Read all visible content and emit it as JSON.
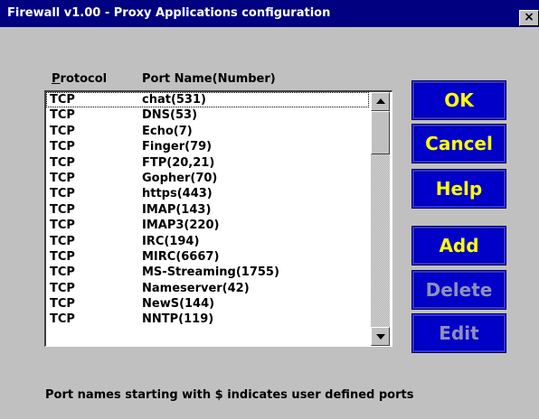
{
  "window": {
    "title": "Firewall v1.00 - Proxy Applications configuration",
    "close_label": "×"
  },
  "list": {
    "header_protocol": "Protocol",
    "header_protocol_mnemonic": "P",
    "header_protocol_rest": "rotocol",
    "header_port": "Port Name(Number)",
    "selected_index": 0,
    "rows": [
      {
        "protocol": "TCP",
        "port": "chat(531)"
      },
      {
        "protocol": "TCP",
        "port": "DNS(53)"
      },
      {
        "protocol": "TCP",
        "port": "Echo(7)"
      },
      {
        "protocol": "TCP",
        "port": "Finger(79)"
      },
      {
        "protocol": "TCP",
        "port": "FTP(20,21)"
      },
      {
        "protocol": "TCP",
        "port": "Gopher(70)"
      },
      {
        "protocol": "TCP",
        "port": "https(443)"
      },
      {
        "protocol": "TCP",
        "port": "IMAP(143)"
      },
      {
        "protocol": "TCP",
        "port": "IMAP3(220)"
      },
      {
        "protocol": "TCP",
        "port": "IRC(194)"
      },
      {
        "protocol": "TCP",
        "port": "MIRC(6667)"
      },
      {
        "protocol": "TCP",
        "port": "MS-Streaming(1755)"
      },
      {
        "protocol": "TCP",
        "port": "Nameserver(42)"
      },
      {
        "protocol": "TCP",
        "port": "NewS(144)"
      },
      {
        "protocol": "TCP",
        "port": "NNTP(119)"
      }
    ]
  },
  "buttons": {
    "ok": "OK",
    "cancel": "Cancel",
    "help": "Help",
    "add": "Add",
    "delete": "Delete",
    "edit": "Edit"
  },
  "button_states": {
    "delete_enabled": false,
    "edit_enabled": false
  },
  "footer": {
    "note": "Port names starting with $ indicates user defined ports"
  },
  "colors": {
    "titlebar": "#000080",
    "dialog_bg": "#c0c0c0",
    "button_bg": "#0000c8",
    "button_text": "#ffff00",
    "button_disabled_text": "#9090b8"
  },
  "icons": {
    "close": "close-icon",
    "scroll_up": "arrow-up-icon",
    "scroll_down": "arrow-down-icon"
  }
}
